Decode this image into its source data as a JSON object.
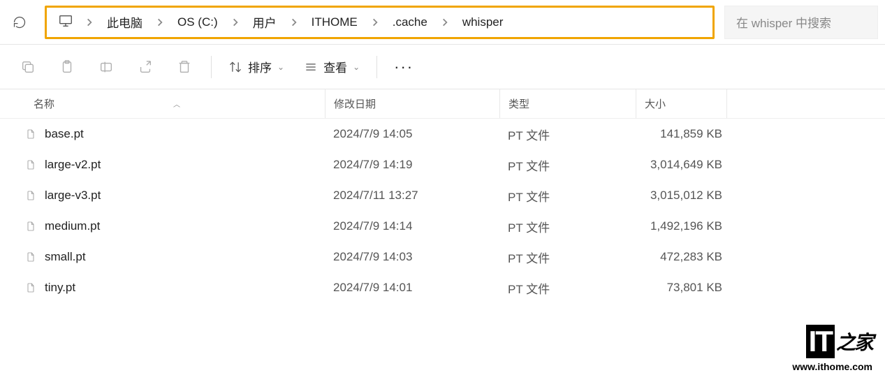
{
  "breadcrumb": {
    "items": [
      "此电脑",
      "OS (C:)",
      "用户",
      "ITHOME",
      ".cache",
      "whisper"
    ]
  },
  "search": {
    "placeholder": "在 whisper 中搜索"
  },
  "toolbar": {
    "sort_label": "排序",
    "view_label": "查看"
  },
  "columns": {
    "name": "名称",
    "date": "修改日期",
    "type": "类型",
    "size": "大小"
  },
  "files": [
    {
      "name": "base.pt",
      "date": "2024/7/9 14:05",
      "type": "PT 文件",
      "size": "141,859 KB"
    },
    {
      "name": "large-v2.pt",
      "date": "2024/7/9 14:19",
      "type": "PT 文件",
      "size": "3,014,649 KB"
    },
    {
      "name": "large-v3.pt",
      "date": "2024/7/11 13:27",
      "type": "PT 文件",
      "size": "3,015,012 KB"
    },
    {
      "name": "medium.pt",
      "date": "2024/7/9 14:14",
      "type": "PT 文件",
      "size": "1,492,196 KB"
    },
    {
      "name": "small.pt",
      "date": "2024/7/9 14:03",
      "type": "PT 文件",
      "size": "472,283 KB"
    },
    {
      "name": "tiny.pt",
      "date": "2024/7/9 14:01",
      "type": "PT 文件",
      "size": "73,801 KB"
    }
  ],
  "watermark": {
    "logo_it": "IT",
    "logo_suffix": "之家",
    "url": "www.ithome.com"
  }
}
